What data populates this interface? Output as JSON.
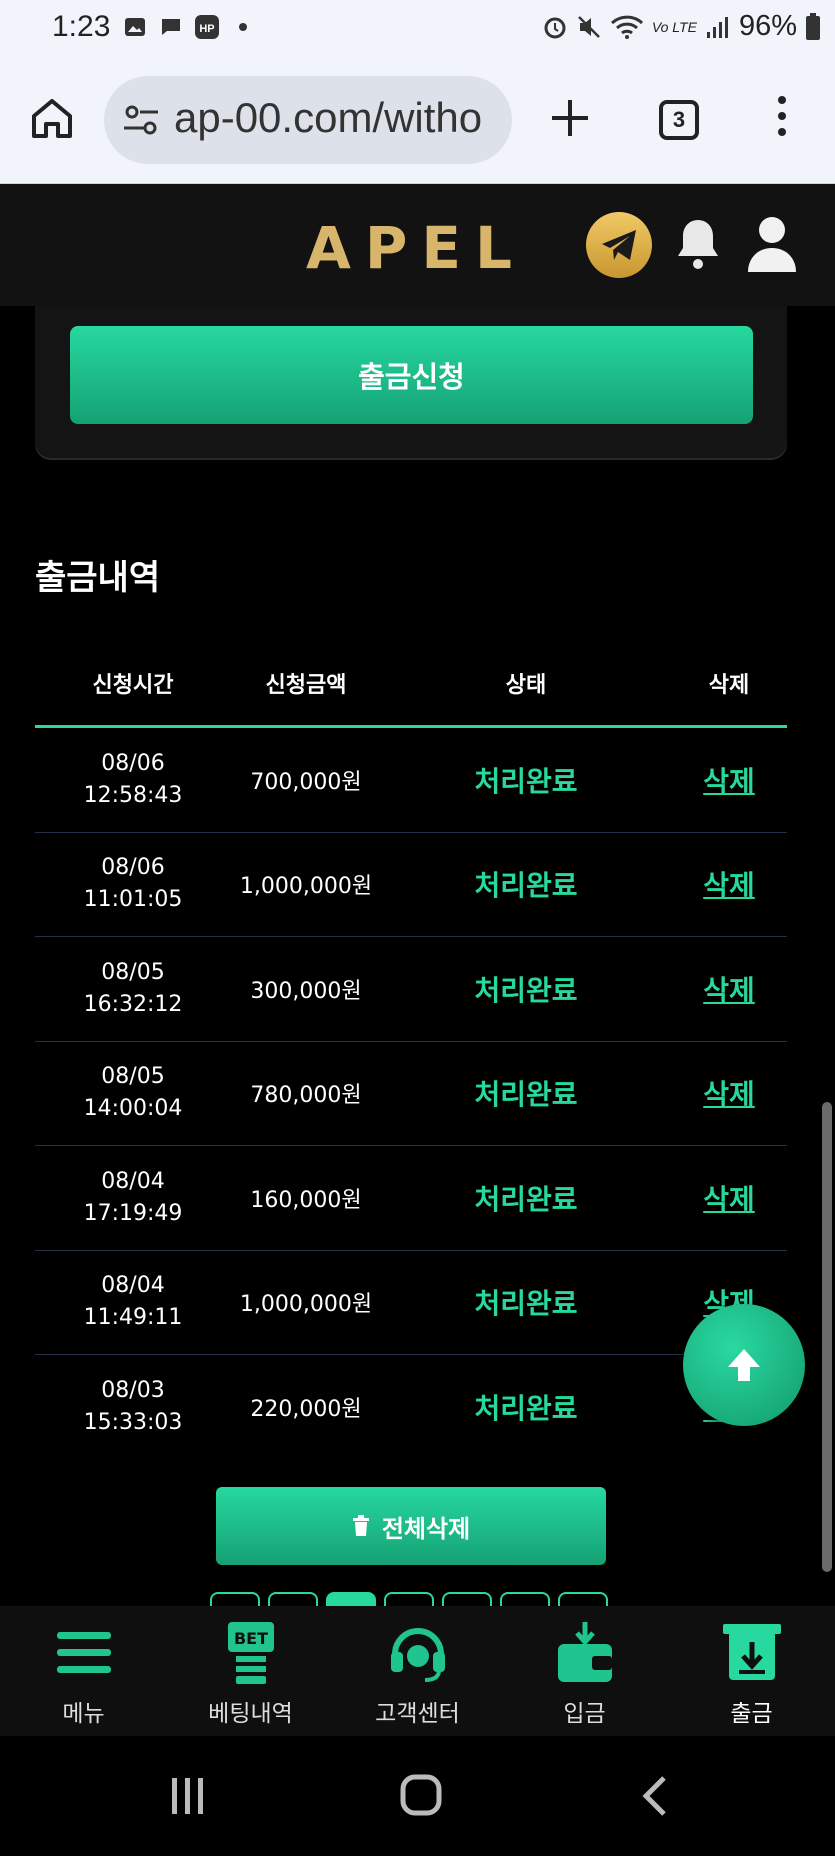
{
  "status_bar": {
    "time": "1:23",
    "battery": "96%",
    "network": "Vo LTE"
  },
  "browser": {
    "url": "ap-00.com/witho",
    "tab_count": "3"
  },
  "site": {
    "logo": "APEL"
  },
  "withdraw": {
    "apply_button": "출금신청",
    "history_title": "출금내역",
    "columns": [
      "신청시간",
      "신청금액",
      "상태",
      "삭제"
    ],
    "rows": [
      {
        "date": "08/06",
        "time": "12:58:43",
        "amount": "700,000원",
        "status": "처리완료",
        "delete": "삭제"
      },
      {
        "date": "08/06",
        "time": "11:01:05",
        "amount": "1,000,000원",
        "status": "처리완료",
        "delete": "삭제"
      },
      {
        "date": "08/05",
        "time": "16:32:12",
        "amount": "300,000원",
        "status": "처리완료",
        "delete": "삭제"
      },
      {
        "date": "08/05",
        "time": "14:00:04",
        "amount": "780,000원",
        "status": "처리완료",
        "delete": "삭제"
      },
      {
        "date": "08/04",
        "time": "17:19:49",
        "amount": "160,000원",
        "status": "처리완료",
        "delete": "삭제"
      },
      {
        "date": "08/04",
        "time": "11:49:11",
        "amount": "1,000,000원",
        "status": "처리완료",
        "delete": "삭제"
      },
      {
        "date": "08/03",
        "time": "15:33:03",
        "amount": "220,000원",
        "status": "처리완료",
        "delete": "삭제"
      }
    ],
    "delete_all": "전체삭제"
  },
  "bottom_nav": [
    {
      "label": "메뉴",
      "icon": "menu-icon"
    },
    {
      "label": "베팅내역",
      "icon": "bet-icon"
    },
    {
      "label": "고객센터",
      "icon": "headset-icon"
    },
    {
      "label": "입금",
      "icon": "wallet-icon"
    },
    {
      "label": "출금",
      "icon": "withdraw-icon"
    }
  ],
  "colors": {
    "accent": "#27d89f",
    "gold": "#d7b56a",
    "background": "#000000"
  }
}
